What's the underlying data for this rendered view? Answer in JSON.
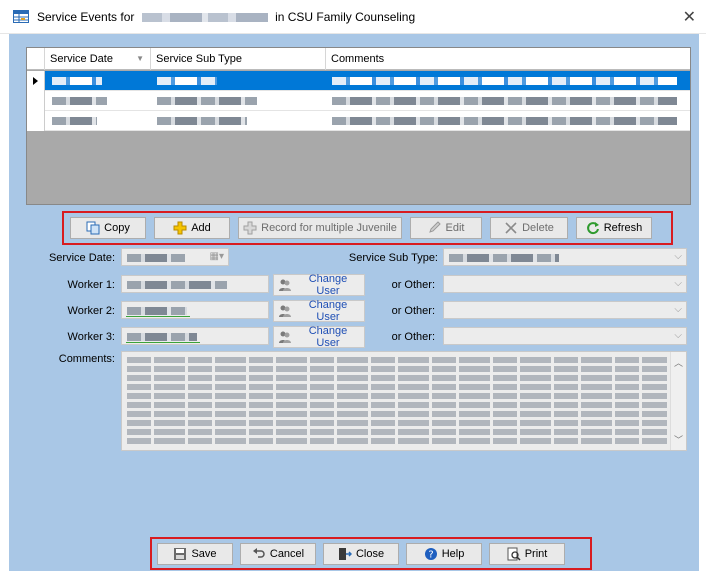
{
  "window": {
    "title_prefix": "Service Events for",
    "title_suffix": "in CSU Family Counseling",
    "close_glyph": "✕",
    "icon": "grid-app-icon"
  },
  "grid": {
    "columns": [
      "Service Date",
      "Service Sub Type",
      "Comments"
    ],
    "sort_indicator": "▼",
    "rows": [
      {
        "selected": true
      },
      {
        "selected": false
      },
      {
        "selected": false
      }
    ]
  },
  "toolbar": {
    "copy": "Copy",
    "add": "Add",
    "record_multiple": "Record for multiple Juvenile",
    "edit": "Edit",
    "delete": "Delete",
    "refresh": "Refresh"
  },
  "form": {
    "service_date_label": "Service Date:",
    "service_sub_type_label": "Service Sub Type:",
    "worker1_label": "Worker 1:",
    "worker2_label": "Worker 2:",
    "worker3_label": "Worker 3:",
    "change_user": "Change User",
    "or_other": "or Other:",
    "comments_label": "Comments:"
  },
  "footer": {
    "save": "Save",
    "cancel": "Cancel",
    "close": "Close",
    "help": "Help",
    "print": "Print"
  },
  "colors": {
    "panel_bg": "#a9c7e6",
    "selection": "#0078d7",
    "highlight_frame": "#d81b20"
  }
}
